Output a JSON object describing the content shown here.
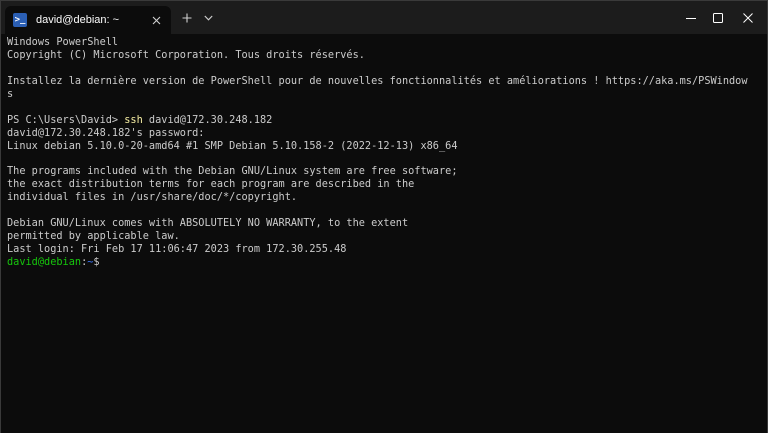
{
  "tab": {
    "title": "david@debian: ~",
    "icon": "powershell-icon"
  },
  "titlebar": {
    "new_tab_icon": "plus-icon",
    "dropdown_icon": "chevron-down-icon",
    "minimize_icon": "minimize-icon",
    "maximize_icon": "maximize-icon",
    "close_icon": "close-icon"
  },
  "terminal": {
    "lines": [
      "Windows PowerShell",
      "Copyright (C) Microsoft Corporation. Tous droits réservés.",
      "",
      "Installez la dernière version de PowerShell pour de nouvelles fonctionnalités et améliorations ! https://aka.ms/PSWindow",
      "s",
      "",
      {
        "prompt": "PS C:\\Users\\David> ",
        "command": "ssh",
        "args": " david@172.30.248.182"
      },
      "david@172.30.248.182's password:",
      "Linux debian 5.10.0-20-amd64 #1 SMP Debian 5.10.158-2 (2022-12-13) x86_64",
      "",
      "The programs included with the Debian GNU/Linux system are free software;",
      "the exact distribution terms for each program are described in the",
      "individual files in /usr/share/doc/*/copyright.",
      "",
      "Debian GNU/Linux comes with ABSOLUTELY NO WARRANTY, to the extent",
      "permitted by applicable law.",
      "Last login: Fri Feb 17 11:06:47 2023 from 172.30.255.48",
      {
        "user_host": "david@debian",
        "sep": ":",
        "path": "~",
        "suffix": "$"
      }
    ]
  },
  "colors": {
    "background": "#0c0c0c",
    "foreground": "#cccccc",
    "command": "#f9f1a5",
    "prompt_user": "#16c60c",
    "prompt_path": "#3b78ff"
  }
}
